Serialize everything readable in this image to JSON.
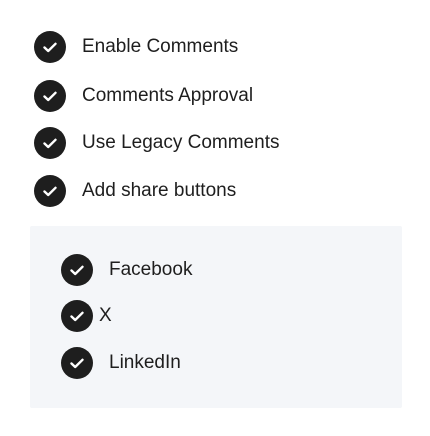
{
  "options": [
    {
      "label": "Enable Comments",
      "checked": true
    },
    {
      "label": "Comments Approval",
      "checked": true
    },
    {
      "label": "Use Legacy Comments",
      "checked": true
    },
    {
      "label": "Add share buttons",
      "checked": true
    }
  ],
  "share_buttons": [
    {
      "label": "Facebook",
      "checked": true
    },
    {
      "label": "X",
      "checked": true
    },
    {
      "label": "LinkedIn",
      "checked": true
    }
  ],
  "icons": {
    "toggle": "check-circle-icon"
  },
  "colors": {
    "toggle_fill": "#1e1e1e",
    "check_mark": "#ffffff",
    "panel_background": "#f4f6f9",
    "text": "#1e1e1e"
  }
}
